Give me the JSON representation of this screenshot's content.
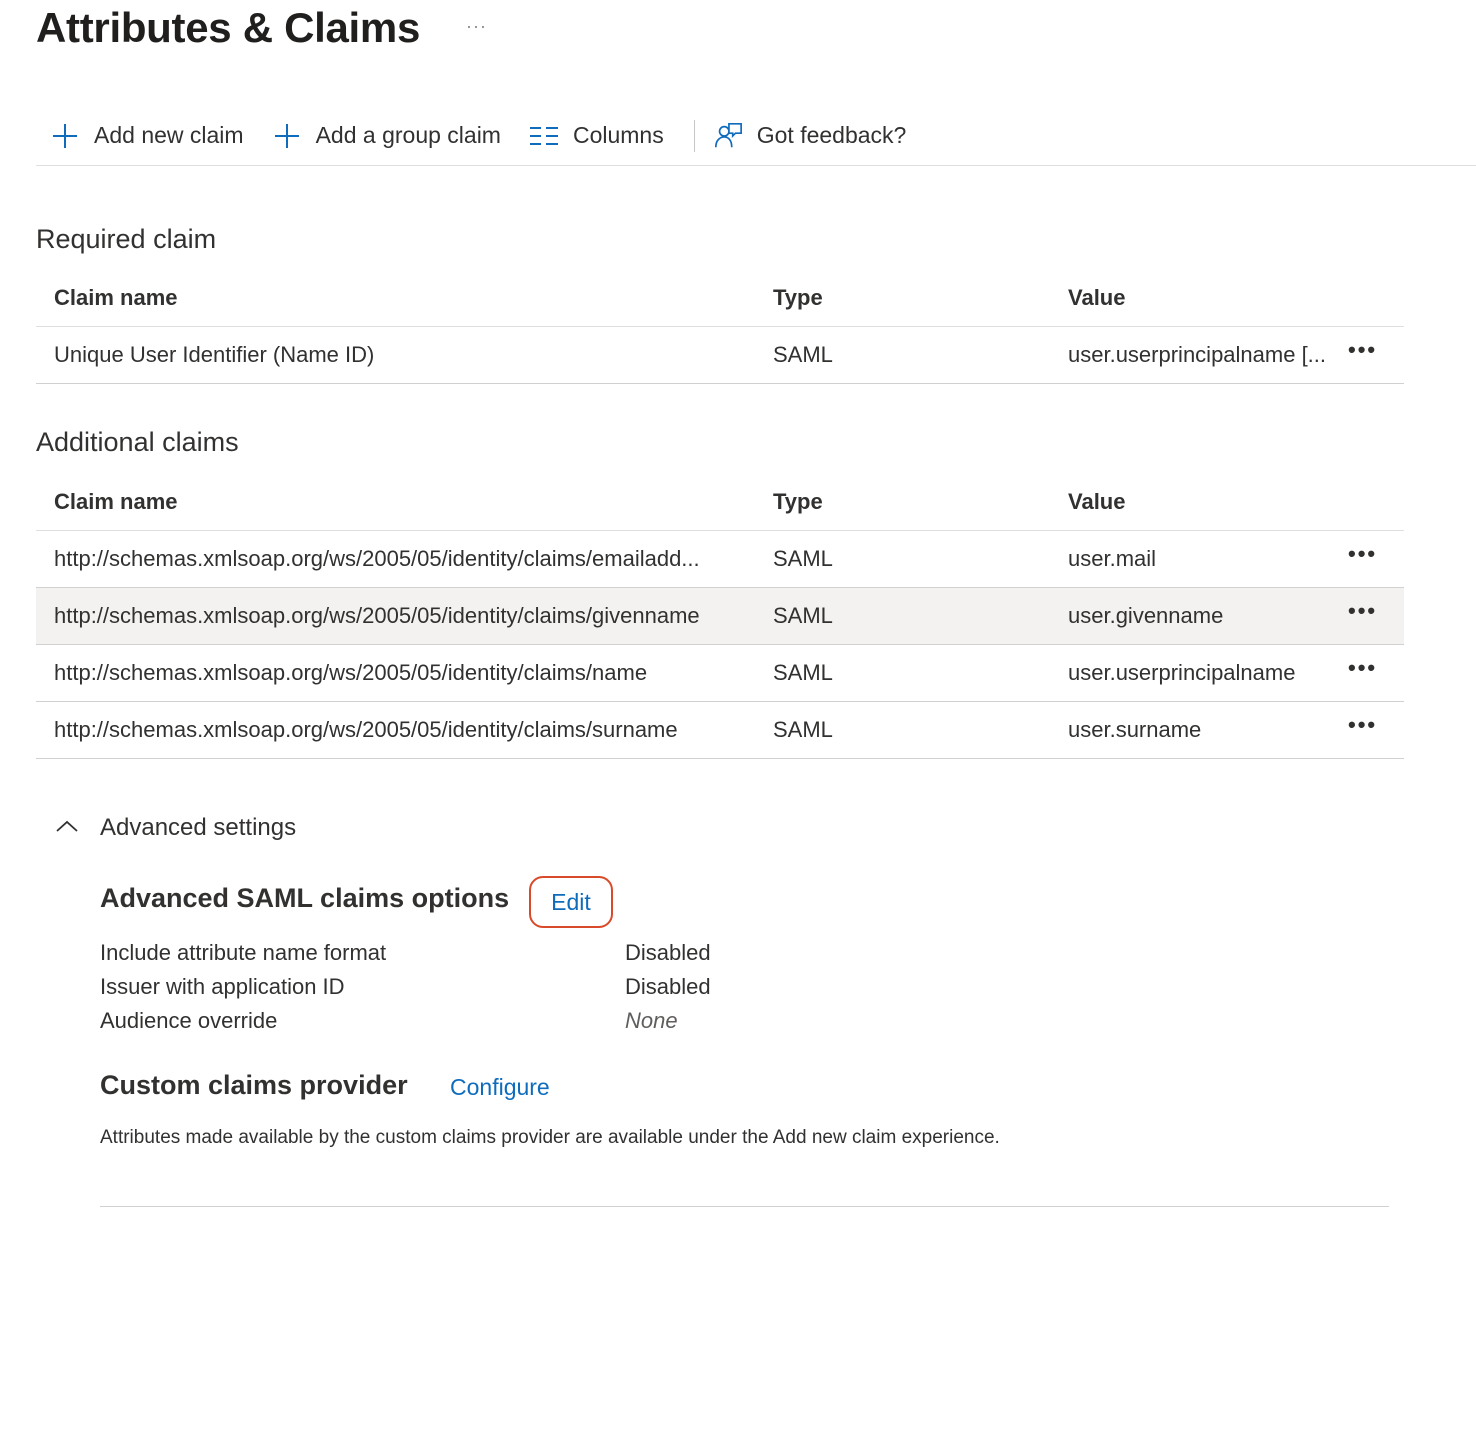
{
  "header": {
    "title": "Attributes & Claims",
    "more": "···"
  },
  "toolbar": {
    "add_claim": "Add new claim",
    "add_group_claim": "Add a group claim",
    "columns": "Columns",
    "feedback": "Got feedback?"
  },
  "required": {
    "title": "Required claim",
    "headers": {
      "name": "Claim name",
      "type": "Type",
      "value": "Value"
    },
    "rows": [
      {
        "name": "Unique User Identifier (Name ID)",
        "type": "SAML",
        "value": "user.userprincipalname [..."
      }
    ]
  },
  "additional": {
    "title": "Additional claims",
    "headers": {
      "name": "Claim name",
      "type": "Type",
      "value": "Value"
    },
    "rows": [
      {
        "name": "http://schemas.xmlsoap.org/ws/2005/05/identity/claims/emailadd...",
        "type": "SAML",
        "value": "user.mail"
      },
      {
        "name": "http://schemas.xmlsoap.org/ws/2005/05/identity/claims/givenname",
        "type": "SAML",
        "value": "user.givenname"
      },
      {
        "name": "http://schemas.xmlsoap.org/ws/2005/05/identity/claims/name",
        "type": "SAML",
        "value": "user.userprincipalname"
      },
      {
        "name": "http://schemas.xmlsoap.org/ws/2005/05/identity/claims/surname",
        "type": "SAML",
        "value": "user.surname"
      }
    ]
  },
  "row_more": "•••",
  "advanced": {
    "toggle_label": "Advanced settings",
    "saml_title": "Advanced SAML claims options",
    "edit_label": "Edit",
    "options": [
      {
        "label": "Include attribute name format",
        "value": "Disabled"
      },
      {
        "label": "Issuer with application ID",
        "value": "Disabled"
      },
      {
        "label": "Audience override",
        "value": "None"
      }
    ],
    "provider_title": "Custom claims provider",
    "configure_label": "Configure",
    "provider_note": "Attributes made available by the custom claims provider are available under the Add new claim experience."
  },
  "colors": {
    "accent": "#0f6cbd",
    "highlight": "#d94a2a"
  },
  "icons": {
    "add": "plus-icon",
    "columns": "columns-icon",
    "feedback": "feedback-icon",
    "collapse": "chevron-up-icon",
    "more": "more-icon"
  }
}
